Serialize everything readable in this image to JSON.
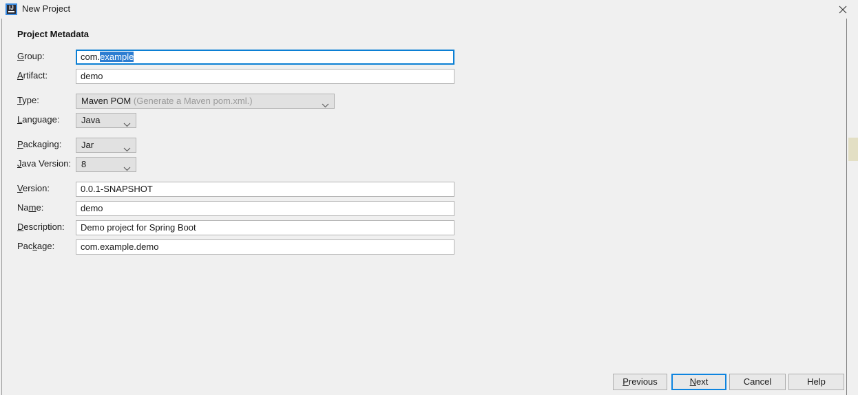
{
  "window": {
    "title": "New Project",
    "app_icon": "intellij-idea-icon",
    "icon_letters": "IJ",
    "close_icon": "close-icon"
  },
  "section": {
    "heading": "Project Metadata"
  },
  "fields": {
    "group": {
      "label_pre": "",
      "label_mnemonic": "G",
      "label_post": "roup:",
      "value_before_caret": "com.",
      "value_selected": "example",
      "value_after": "",
      "focused": true
    },
    "artifact": {
      "label_pre": "",
      "label_mnemonic": "A",
      "label_post": "rtifact:",
      "value": "demo"
    },
    "type": {
      "label_pre": "",
      "label_mnemonic": "T",
      "label_post": "ype:",
      "value": "Maven POM",
      "hint": "(Generate a Maven pom.xml.)"
    },
    "language": {
      "label_pre": "",
      "label_mnemonic": "L",
      "label_post": "anguage:",
      "value": "Java"
    },
    "packaging": {
      "label_pre": "",
      "label_mnemonic": "P",
      "label_post": "ackaging:",
      "value": "Jar"
    },
    "java_version": {
      "label_pre": "",
      "label_mnemonic": "J",
      "label_post": "ava Version:",
      "value": "8"
    },
    "version": {
      "label_pre": "",
      "label_mnemonic": "V",
      "label_post": "ersion:",
      "value": "0.0.1-SNAPSHOT"
    },
    "name": {
      "label_pre": "Na",
      "label_mnemonic": "m",
      "label_post": "e:",
      "value": "demo"
    },
    "description": {
      "label_pre": "",
      "label_mnemonic": "D",
      "label_post": "escription:",
      "value": "Demo project for Spring Boot"
    },
    "package": {
      "label_pre": "Pac",
      "label_mnemonic": "k",
      "label_post": "age:",
      "value": "com.example.demo"
    }
  },
  "buttons": {
    "previous": {
      "pre": "",
      "mnemonic": "P",
      "post": "revious"
    },
    "next": {
      "pre": "",
      "mnemonic": "N",
      "post": "ext",
      "is_default": true
    },
    "cancel": {
      "pre": "Cancel",
      "mnemonic": "",
      "post": ""
    },
    "help": {
      "pre": "Help",
      "mnemonic": "",
      "post": ""
    }
  },
  "colors": {
    "dialog_background": "#f0f0f0",
    "focus_blue": "#0b7fd4",
    "selection_blue": "#2d7dd1",
    "default_button_border": "#0e84df",
    "field_border": "#b4b4b4",
    "combo_background": "#e1e1e1",
    "scrollbar_thumb": "#e3dfc4",
    "hint_text": "#9a9a9a"
  }
}
